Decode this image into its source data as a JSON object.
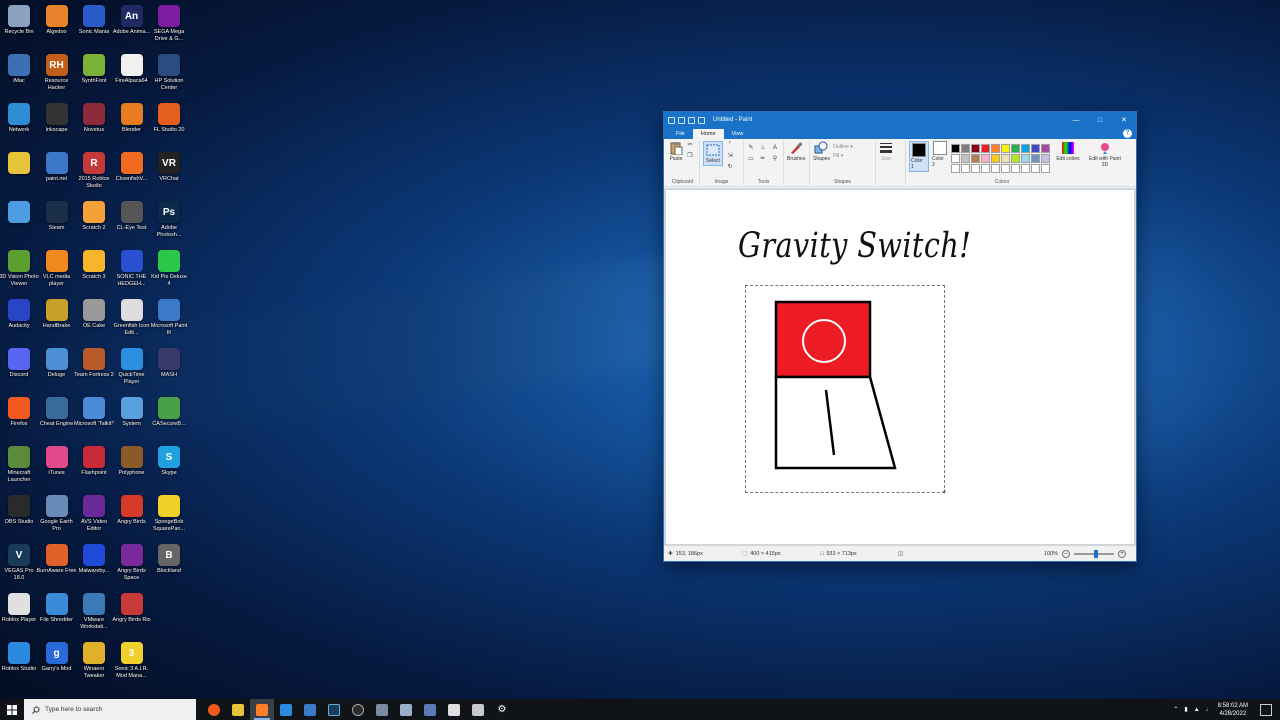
{
  "desktop": {
    "icons": [
      {
        "label": "Recycle Bin",
        "color": "#8aa4bf"
      },
      {
        "label": "Algedoo",
        "color": "#e7832a"
      },
      {
        "label": "Sonic Mania",
        "color": "#2a5cc9"
      },
      {
        "label": "Adobe Anima...",
        "color": "#1f2a63",
        "glyph": "An"
      },
      {
        "label": "SEGA Mega Drive & G...",
        "color": "#7a1d9e"
      },
      {
        "label": "iMac",
        "color": "#3c6fb3"
      },
      {
        "label": "Resource Hacker",
        "color": "#c25d1a",
        "glyph": "RH"
      },
      {
        "label": "SynthFont",
        "color": "#7ab23a"
      },
      {
        "label": "FireAlpaca64",
        "color": "#f0f0f0"
      },
      {
        "label": "HP Solution Center",
        "color": "#2b4c7e"
      },
      {
        "label": "Network",
        "color": "#2f8bd4"
      },
      {
        "label": "Inkscape",
        "color": "#333333"
      },
      {
        "label": "Novetus",
        "color": "#8c2a3a"
      },
      {
        "label": "Blender",
        "color": "#e77b1f"
      },
      {
        "label": "FL Studio 20",
        "color": "#e45f1d"
      },
      {
        "label": "",
        "color": "#e7c33a"
      },
      {
        "label": "paint.net",
        "color": "#3d77c8"
      },
      {
        "label": "2015 Roblox Studio",
        "color": "#c43a3a",
        "glyph": "R"
      },
      {
        "label": "ClownfishV...",
        "color": "#f06b1f"
      },
      {
        "label": "VRChat",
        "color": "#222222",
        "glyph": "VR"
      },
      {
        "label": "",
        "color": "#4d9be0"
      },
      {
        "label": "Steam",
        "color": "#1b2f4a"
      },
      {
        "label": "Scratch 2",
        "color": "#f4a13a"
      },
      {
        "label": "CL-Eye Test",
        "color": "#555555"
      },
      {
        "label": "Adobe Photosh...",
        "color": "#0b2a4a",
        "glyph": "Ps"
      },
      {
        "label": "3D Vision Photo Viewer",
        "color": "#5c9e2f"
      },
      {
        "label": "VLC media player",
        "color": "#f0871f"
      },
      {
        "label": "Scratch 3",
        "color": "#f6b52a"
      },
      {
        "label": "SONIC THE HEDGEH...",
        "color": "#2a4fd1"
      },
      {
        "label": "Kid Pix Deluxe 4",
        "color": "#2ac84a"
      },
      {
        "label": "Audacity",
        "color": "#2a44c8"
      },
      {
        "label": "HandBrake",
        "color": "#c8a12a"
      },
      {
        "label": "OE Cake",
        "color": "#9a9a9a"
      },
      {
        "label": "Greenfish Icon Edit...",
        "color": "#dddddd"
      },
      {
        "label": "Microsoft Paint It!",
        "color": "#3a7ac8"
      },
      {
        "label": "Discord",
        "color": "#5865f2"
      },
      {
        "label": "Deluge",
        "color": "#4a8fd8"
      },
      {
        "label": "Team Fortress 2",
        "color": "#b85a2a"
      },
      {
        "label": "QuickTime Player",
        "color": "#2a8fe0"
      },
      {
        "label": "MASH",
        "color": "#3a3a6a"
      },
      {
        "label": "Firefox",
        "color": "#f05a1f"
      },
      {
        "label": "Cheat Engine",
        "color": "#3a6a9a"
      },
      {
        "label": "Microsoft 'Talkit!'",
        "color": "#4a8ad8"
      },
      {
        "label": "System",
        "color": "#5aa0e0"
      },
      {
        "label": "CASecureB...",
        "color": "#4aa04a"
      },
      {
        "label": "Minecraft Launcher",
        "color": "#5a8a3a"
      },
      {
        "label": "iTunes",
        "color": "#e04a8a"
      },
      {
        "label": "Flashpoint",
        "color": "#c82a3a"
      },
      {
        "label": "Polyphone",
        "color": "#8a5a2a"
      },
      {
        "label": "Skype",
        "color": "#1fa0e0",
        "glyph": "S"
      },
      {
        "label": "OBS Studio",
        "color": "#2a2a2a"
      },
      {
        "label": "Google Earth Pro",
        "color": "#6a8ab8"
      },
      {
        "label": "AVS Video Editor",
        "color": "#6a2a9a"
      },
      {
        "label": "Angry Birds",
        "color": "#d83a2a"
      },
      {
        "label": "SpongeBob SquarePan...",
        "color": "#f0d02a"
      },
      {
        "label": "VEGAS Pro 18.0",
        "color": "#1a3a5a",
        "glyph": "V"
      },
      {
        "label": "BurnAware Free",
        "color": "#e0602a"
      },
      {
        "label": "Malwareby...",
        "color": "#1f4ad8"
      },
      {
        "label": "Angry Birds Space",
        "color": "#7a2a9a"
      },
      {
        "label": "Blockland",
        "color": "#666666",
        "glyph": "B"
      },
      {
        "label": "Roblox Player",
        "color": "#e0e0e0"
      },
      {
        "label": "File Shredder",
        "color": "#3a8ad8"
      },
      {
        "label": "VMware Workstati...",
        "color": "#3a7ab8"
      },
      {
        "label": "Angry Birds Rio",
        "color": "#c83a3a"
      },
      {
        "label": "",
        "color": "#00000000"
      },
      {
        "label": "Roblox Studio",
        "color": "#2a8ae0"
      },
      {
        "label": "Garry's Mod",
        "color": "#2a6ad8",
        "glyph": "g"
      },
      {
        "label": "Winaero Tweaker",
        "color": "#e0b02a"
      },
      {
        "label": "Sonic 3 A.I.R. Mod Mana...",
        "color": "#f0d02a",
        "glyph": "3"
      },
      {
        "label": "",
        "color": "#00000000"
      }
    ]
  },
  "paint": {
    "title": "Untitled - Paint",
    "tabs": [
      "File",
      "Home",
      "View"
    ],
    "groups": {
      "clipboard": "Clipboard",
      "image": "Image",
      "tools": "Tools",
      "shapes": "Shapes",
      "colors": "Colors"
    },
    "buttons": {
      "paste": "Paste",
      "select": "Select",
      "brushes": "Brushes",
      "shapes": "Shapes",
      "outline": "Outline",
      "fill": "Fill",
      "size": "Size",
      "color1": "Color 1",
      "color2": "Color 2",
      "edit_colors": "Edit colors",
      "edit_3d": "Edit with Paint 3D"
    },
    "palette": [
      "#000000",
      "#7f7f7f",
      "#880015",
      "#ed1c24",
      "#ff7f27",
      "#fff200",
      "#22b14c",
      "#00a2e8",
      "#3f48cc",
      "#a349a4",
      "#ffffff",
      "#c3c3c3",
      "#b97a57",
      "#ffaec9",
      "#ffc90e",
      "#efe4b0",
      "#b5e61d",
      "#99d9ea",
      "#7092be",
      "#c8bfe7",
      "#ffffff",
      "#ffffff",
      "#ffffff",
      "#ffffff",
      "#ffffff",
      "#ffffff",
      "#ffffff",
      "#ffffff",
      "#ffffff",
      "#ffffff"
    ],
    "color1": "#000000",
    "color2": "#ffffff",
    "canvas_text": "Gravity Switch!",
    "status": {
      "cursor": "153, 186px",
      "selection": "400 × 415px",
      "size": "933 × 713px",
      "zoom": "100%"
    }
  },
  "taskbar": {
    "search_placeholder": "Type here to search",
    "time": "8:58:02 AM",
    "date": "4/28/2022"
  }
}
